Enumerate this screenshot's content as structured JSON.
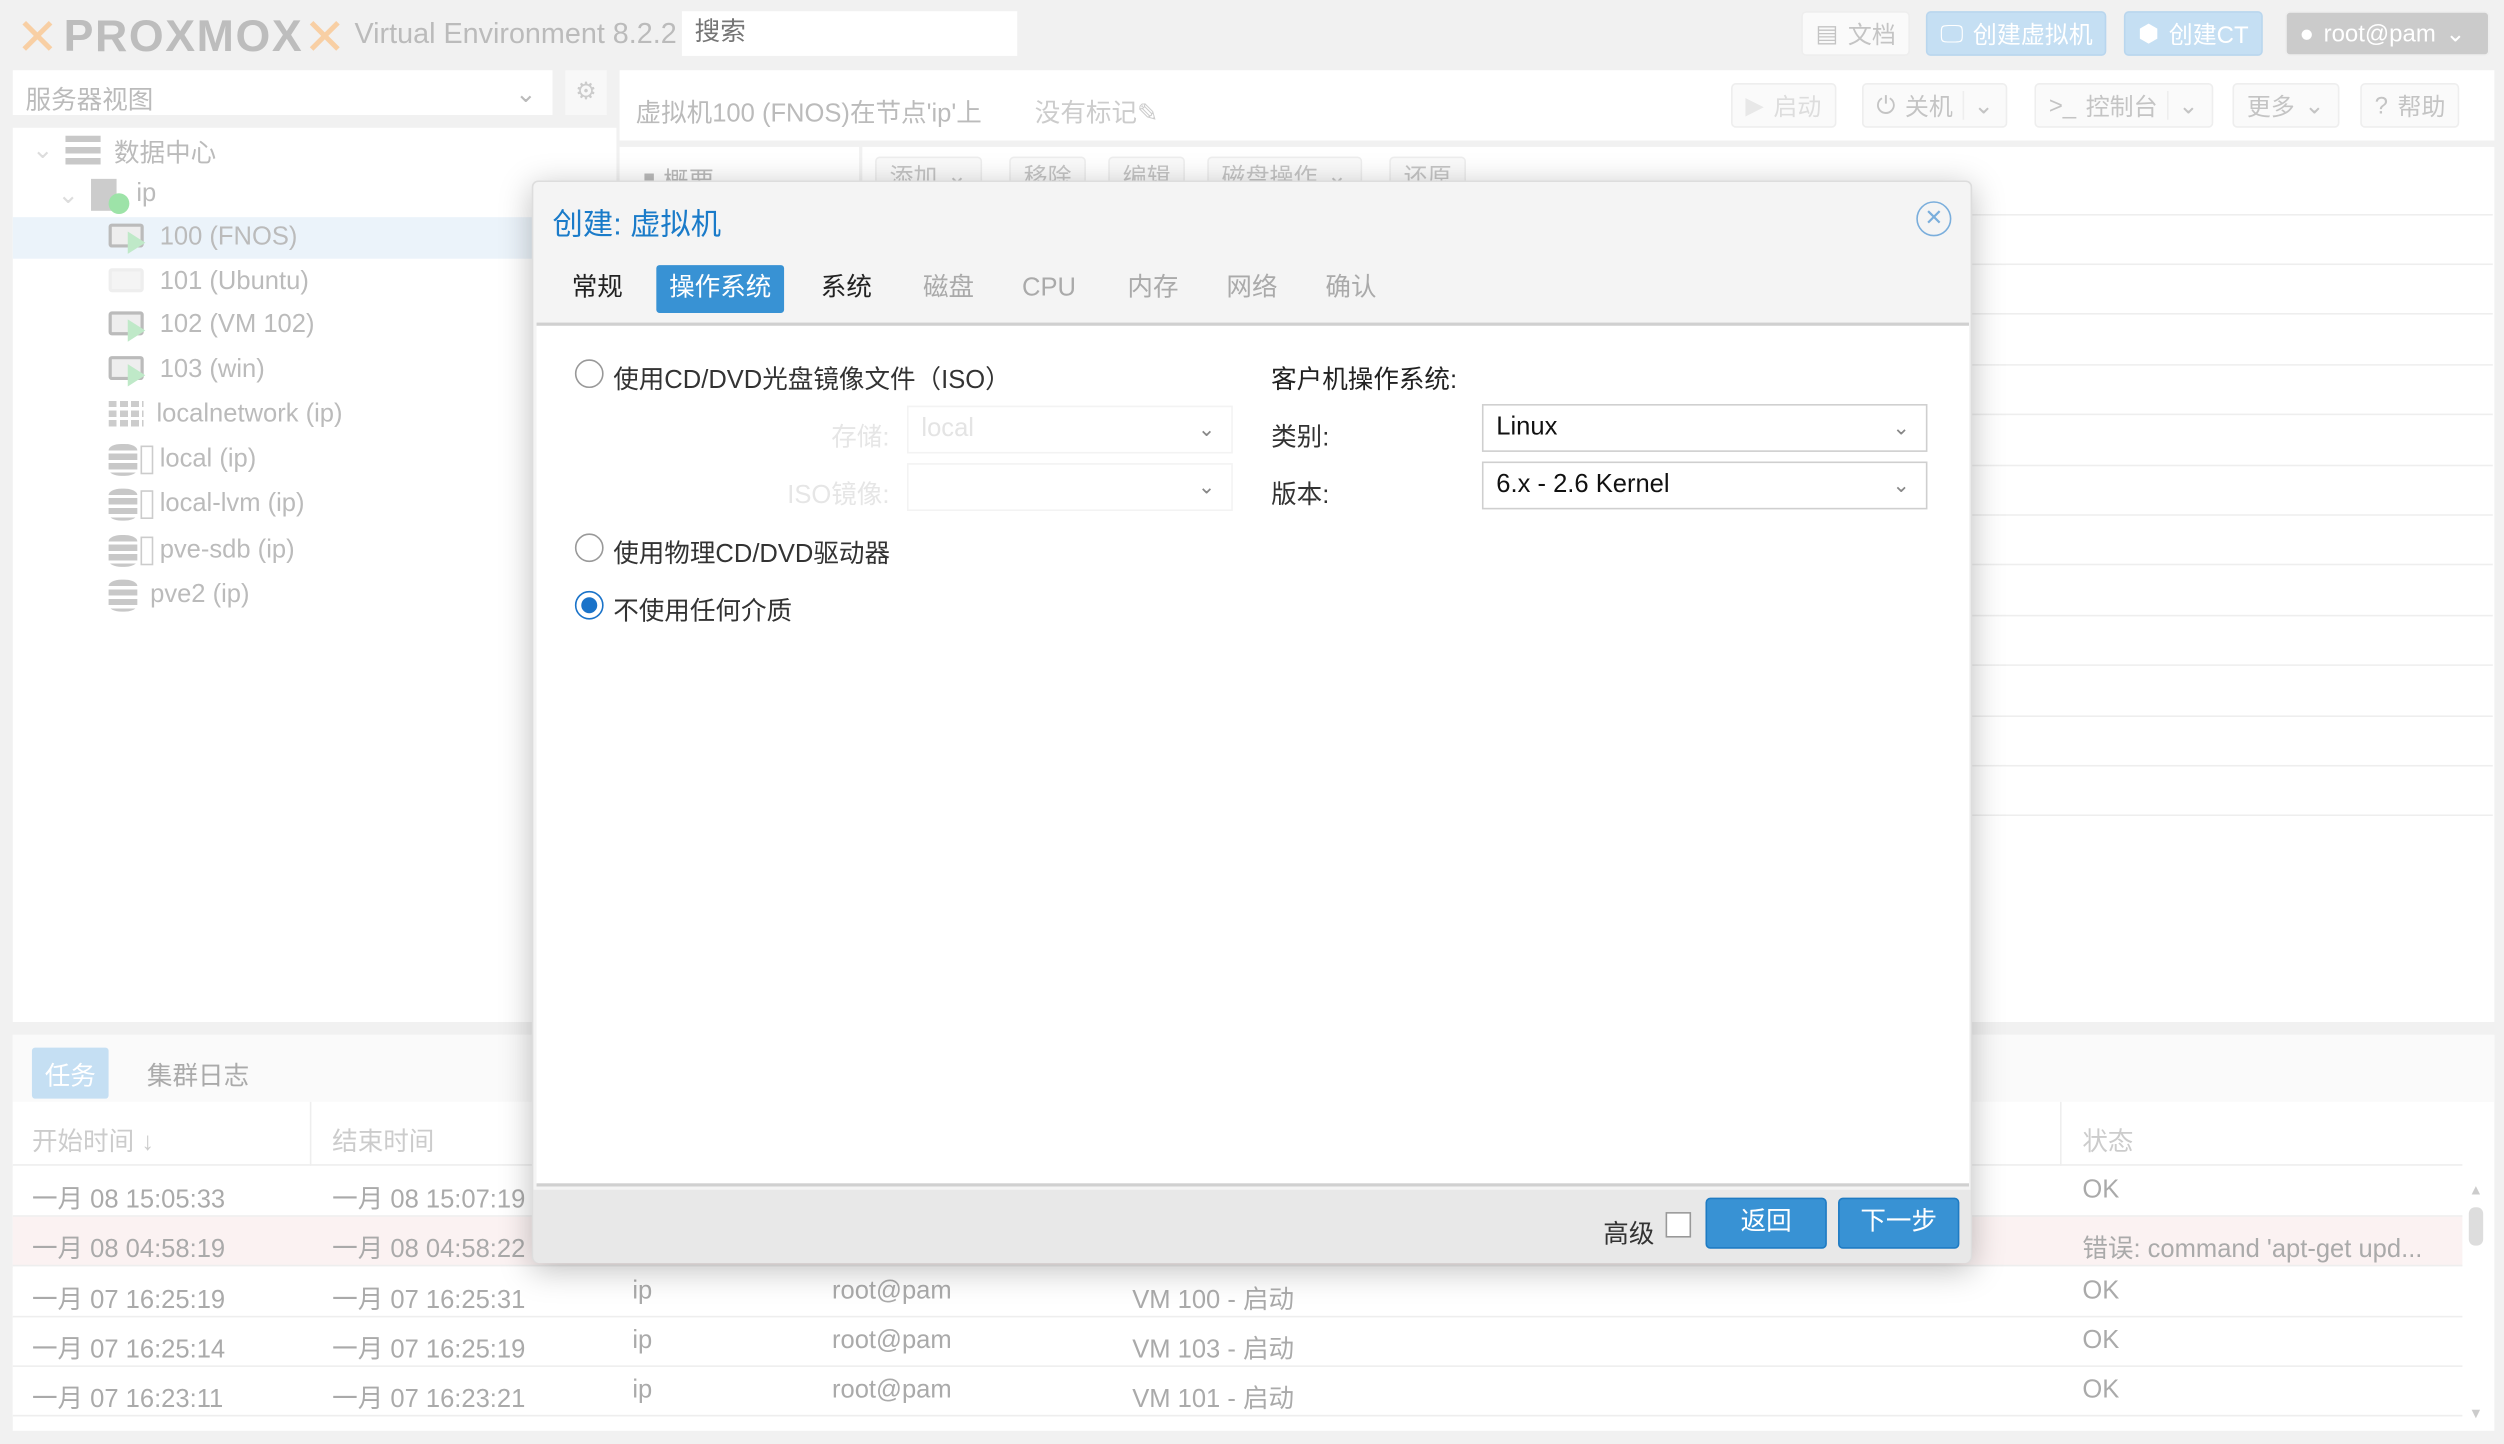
{
  "header": {
    "logo": "PROXMOX",
    "version": "Virtual Environment 8.2.2",
    "search_placeholder": "搜索",
    "docs": "文档",
    "create_vm": "创建虚拟机",
    "create_ct": "创建CT",
    "user": "root@pam"
  },
  "sidebar": {
    "view": "服务器视图",
    "tree": [
      {
        "label": "数据中心",
        "icon": "datacenter-icon"
      },
      {
        "label": "ip",
        "icon": "node-online-icon"
      },
      {
        "label": "100 (FNOS)",
        "icon": "vm-running-icon",
        "selected": true
      },
      {
        "label": "101 (Ubuntu)",
        "icon": "vm-stopped-icon"
      },
      {
        "label": "102 (VM 102)",
        "icon": "vm-running-icon"
      },
      {
        "label": "103 (win)",
        "icon": "vm-running-icon"
      },
      {
        "label": "localnetwork (ip)",
        "icon": "network-icon"
      },
      {
        "label": "local (ip)",
        "icon": "storage-icon"
      },
      {
        "label": "local-lvm (ip)",
        "icon": "storage-icon"
      },
      {
        "label": "pve-sdb (ip)",
        "icon": "storage-icon"
      },
      {
        "label": "pve2 (ip)",
        "icon": "storage-unknown-icon"
      }
    ]
  },
  "main": {
    "title": "虚拟机100 (FNOS)在节点'ip'上",
    "tags": "没有标记",
    "buttons": {
      "start": "启动",
      "shutdown": "关机",
      "console": "控制台",
      "more": "更多",
      "help": "帮助"
    },
    "tab": "概要",
    "toolbar": [
      "添加",
      "移除",
      "编辑",
      "磁盘操作",
      "还原"
    ]
  },
  "dialog": {
    "title": "创建: 虚拟机",
    "tabs": [
      "常规",
      "操作系统",
      "系统",
      "磁盘",
      "CPU",
      "内存",
      "网络",
      "确认"
    ],
    "active_tab": 1,
    "iso_radio": "使用CD/DVD光盘镜像文件（ISO）",
    "storage_label": "存储:",
    "storage_value": "local",
    "iso_label": "ISO镜像:",
    "iso_value": "",
    "physical_radio": "使用物理CD/DVD驱动器",
    "none_radio": "不使用任何介质",
    "selected_media": "none",
    "guest_os": "客户机操作系统:",
    "type_label": "类别:",
    "type_value": "Linux",
    "version_label": "版本:",
    "version_value": "6.x - 2.6 Kernel",
    "advanced": "高级",
    "advanced_checked": false,
    "back": "返回",
    "next": "下一步"
  },
  "tasks": {
    "tabs": [
      "任务",
      "集群日志"
    ],
    "headers": {
      "start": "开始时间",
      "end": "结束时间",
      "status": "状态"
    },
    "rows": [
      {
        "start": "一月 08 15:05:33",
        "end": "一月 08 15:07:19",
        "node": "",
        "user": "",
        "desc": "",
        "status": "OK"
      },
      {
        "start": "一月 08 04:58:19",
        "end": "一月 08 04:58:22",
        "node": "",
        "user": "",
        "desc": "",
        "status": "错误: command 'apt-get upd...",
        "error": true
      },
      {
        "start": "一月 07 16:25:19",
        "end": "一月 07 16:25:31",
        "node": "ip",
        "user": "root@pam",
        "desc": "VM 100 - 启动",
        "status": "OK"
      },
      {
        "start": "一月 07 16:25:14",
        "end": "一月 07 16:25:19",
        "node": "ip",
        "user": "root@pam",
        "desc": "VM 103 - 启动",
        "status": "OK"
      },
      {
        "start": "一月 07 16:23:11",
        "end": "一月 07 16:23:21",
        "node": "ip",
        "user": "root@pam",
        "desc": "VM 101 - 启动",
        "status": "OK"
      }
    ]
  },
  "colors": {
    "accent": "#3892d4",
    "error_row": "#fbf2f2"
  }
}
